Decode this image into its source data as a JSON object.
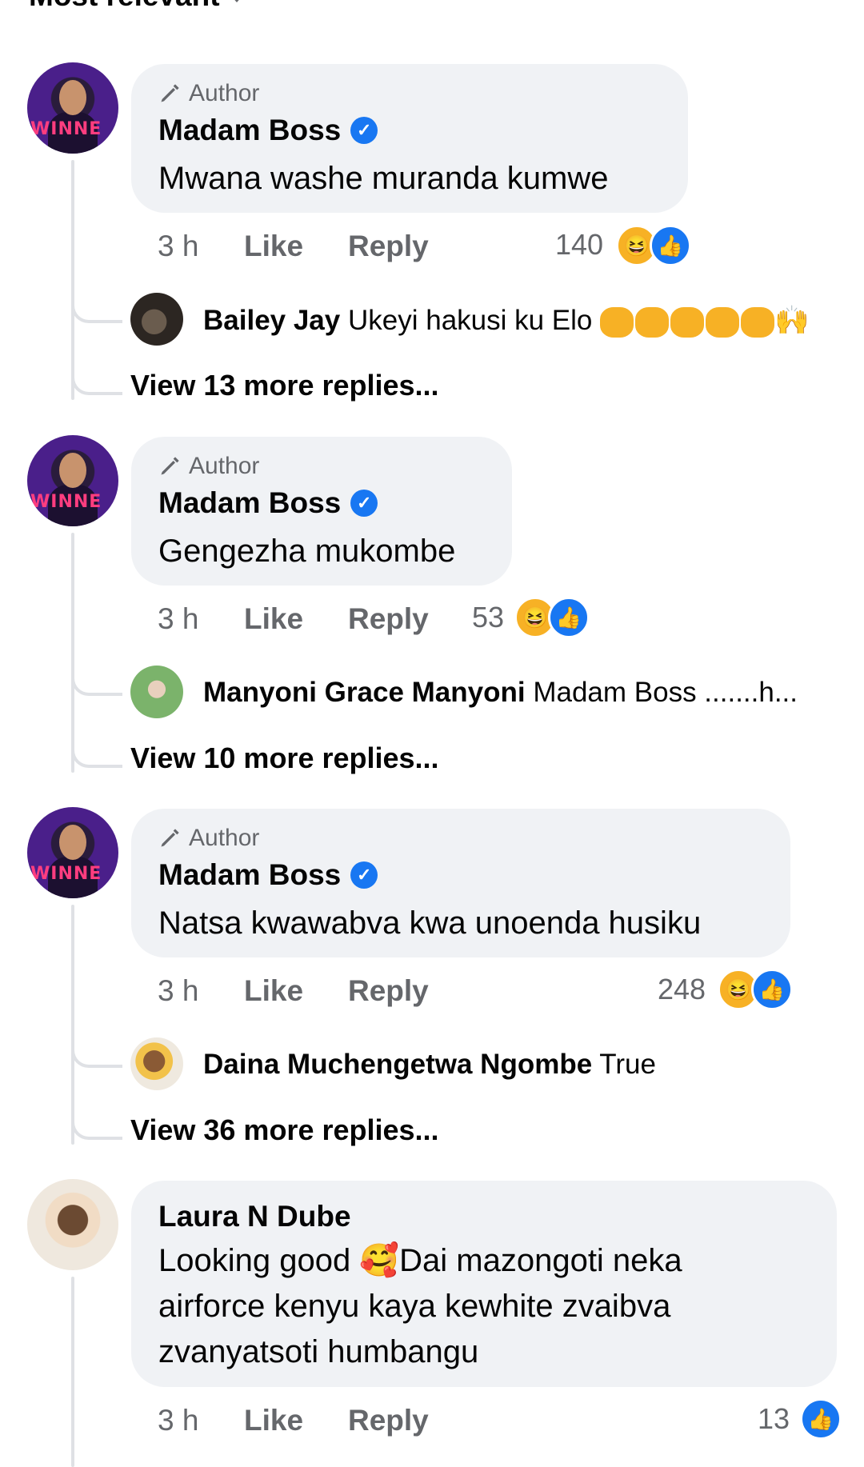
{
  "sort_label": "Most relevant",
  "comments": [
    {
      "badge": "Author",
      "name": "Madam Boss",
      "text": "Mwana washe muranda kumwe",
      "time": "3 h",
      "like_label": "Like",
      "reply_label": "Reply",
      "reaction_count": "140",
      "reply_preview": {
        "name": "Bailey Jay",
        "text": "Ukeyi hakusi ku Elo"
      },
      "view_more": "View 13 more replies..."
    },
    {
      "badge": "Author",
      "name": "Madam Boss",
      "text": "Gengezha mukombe",
      "time": "3 h",
      "like_label": "Like",
      "reply_label": "Reply",
      "reaction_count": "53",
      "reply_preview": {
        "name": "Manyoni Grace Manyoni",
        "text": "Madam Boss .......h..."
      },
      "view_more": "View 10 more replies..."
    },
    {
      "badge": "Author",
      "name": "Madam Boss",
      "text": "Natsa kwawabva kwa unoenda husiku",
      "time": "3 h",
      "like_label": "Like",
      "reply_label": "Reply",
      "reaction_count": "248",
      "reply_preview": {
        "name": "Daina Muchengetwa Ngombe",
        "text": "True"
      },
      "view_more": "View 36 more replies..."
    },
    {
      "name": "Laura N Dube",
      "text_lines": [
        "Looking  good  🥰Dai mazongoti neka",
        "airforce  kenyu kaya kewhite zvaibva",
        "zvanyatsoti humbangu"
      ],
      "time": "3 h",
      "like_label": "Like",
      "reply_label": "Reply",
      "reaction_count": "13"
    }
  ],
  "colors": {
    "verified": "#1877f2",
    "bubble": "#f0f2f5",
    "muted": "#65676b",
    "haha": "#f7b125"
  }
}
